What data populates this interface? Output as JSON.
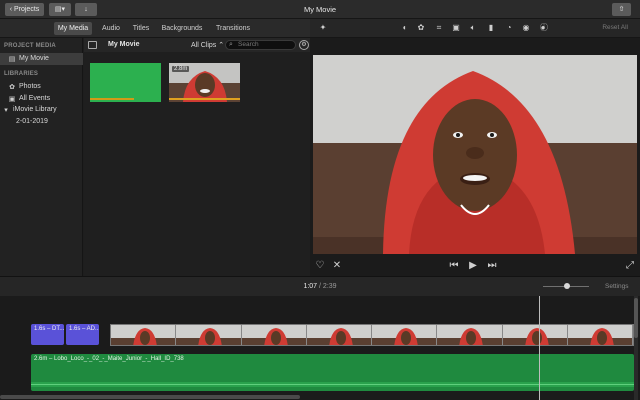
{
  "titlebar": {
    "projects_label": "Projects",
    "window_title": "My Movie"
  },
  "browser_tabs": [
    "My Media",
    "Audio",
    "Titles",
    "Backgrounds",
    "Transitions"
  ],
  "viewer_toolbar": {
    "reset_label": "Reset All",
    "icons": [
      "magic-wand-icon",
      "color-balance-icon",
      "color-correction-icon",
      "crop-icon",
      "stabilization-icon",
      "volume-icon",
      "equalizer-icon",
      "speed-icon",
      "noise-reduction-icon",
      "clip-filter-icon",
      "info-icon"
    ]
  },
  "sidebar": {
    "project_media_heading": "PROJECT MEDIA",
    "project_item": "My Movie",
    "libraries_heading": "LIBRARIES",
    "items": [
      {
        "label": "Photos",
        "icon": "photos-icon"
      },
      {
        "label": "All Events",
        "icon": "events-icon"
      },
      {
        "label": "iMovie Library",
        "icon": "disclosure-triangle-icon"
      },
      {
        "label": "2-01-2019",
        "icon": ""
      }
    ]
  },
  "media_browser": {
    "title": "My Movie",
    "filter": "All Clips",
    "search_placeholder": "Search",
    "clips": [
      {
        "kind": "green",
        "duration": ""
      },
      {
        "kind": "video",
        "duration": "2.8m"
      }
    ]
  },
  "timeline": {
    "current": "1:07",
    "separator": "/",
    "total": "2:39",
    "settings_label": "Settings",
    "audio_clips": [
      "1.6s – DT...",
      "1.6s – AD..."
    ],
    "music_label": "2.6m – Lobo_Loco_-_02_-_Maite_Junior_-_Hall_ID_738"
  },
  "colors": {
    "background": "#1e1e1e",
    "audio_clip": "#5a52d8",
    "music_clip": "#1f8a3f",
    "green_clip": "#2cb04f",
    "hoodie": "#cf3b33"
  }
}
